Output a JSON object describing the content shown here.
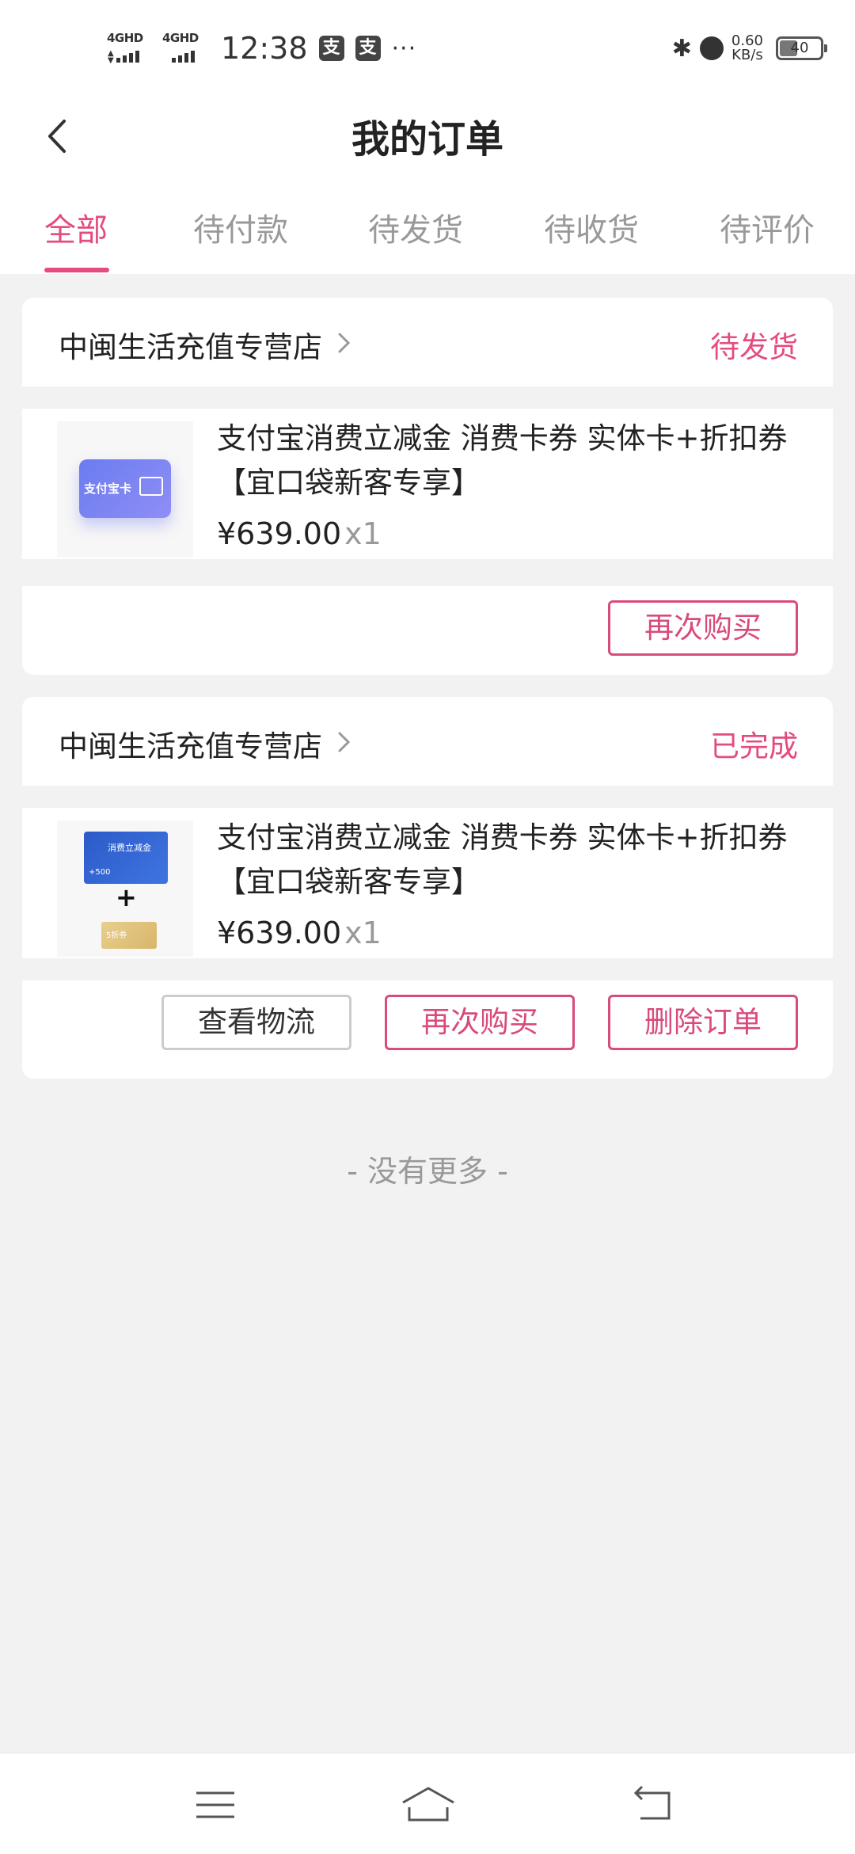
{
  "status_bar": {
    "signal1_label": "4GHD",
    "signal2_label": "4GHD",
    "time": "12:38",
    "pay1": "支",
    "pay2": "支",
    "more": "···",
    "speed_value": "0.60",
    "speed_unit": "KB/s",
    "battery": "40"
  },
  "header": {
    "title": "我的订单"
  },
  "tabs": [
    {
      "label": "全部",
      "active": true
    },
    {
      "label": "待付款"
    },
    {
      "label": "待发货"
    },
    {
      "label": "待收货"
    },
    {
      "label": "待评价"
    }
  ],
  "orders": [
    {
      "store": "中闽生活充值专营店",
      "status": "待发货",
      "thumb_text": "支付宝卡",
      "title": "支付宝消费立减金 消费卡券 实体卡+折扣券【宜口袋新客专享】",
      "price": "¥639.00",
      "qty": "x1",
      "actions": [
        "再次购买"
      ]
    },
    {
      "store": "中闽生活充值专营店",
      "status": "已完成",
      "thumb_text_top": "消费立减金",
      "thumb_text_amount": "+500",
      "thumb_plus": "+",
      "thumb_text_bottom": "5折券",
      "title": "支付宝消费立减金 消费卡券 实体卡+折扣券【宜口袋新客专享】",
      "price": "¥639.00",
      "qty": "x1",
      "actions": [
        "查看物流",
        "再次购买",
        "删除订单"
      ]
    }
  ],
  "footer": {
    "no_more": "- 没有更多 -"
  },
  "colors": {
    "accent": "#e44b80",
    "background": "#f2f2f2"
  },
  "nav_icons": [
    "menu-icon",
    "home-icon",
    "back-icon"
  ]
}
